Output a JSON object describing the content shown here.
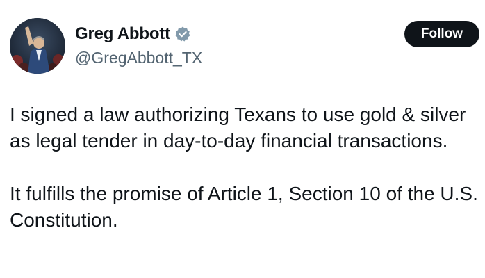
{
  "author": {
    "display_name": "Greg Abbott",
    "handle": "@GregAbbott_TX",
    "verified": true,
    "verified_color": "#829aab"
  },
  "actions": {
    "follow_label": "Follow"
  },
  "tweet": {
    "paragraphs": [
      "I signed a law authorizing Texans to use gold & silver as legal tender in day-to-day financial transactions.",
      "It fulfills the promise of Article 1, Section 10 of the U.S. Constitution."
    ]
  }
}
